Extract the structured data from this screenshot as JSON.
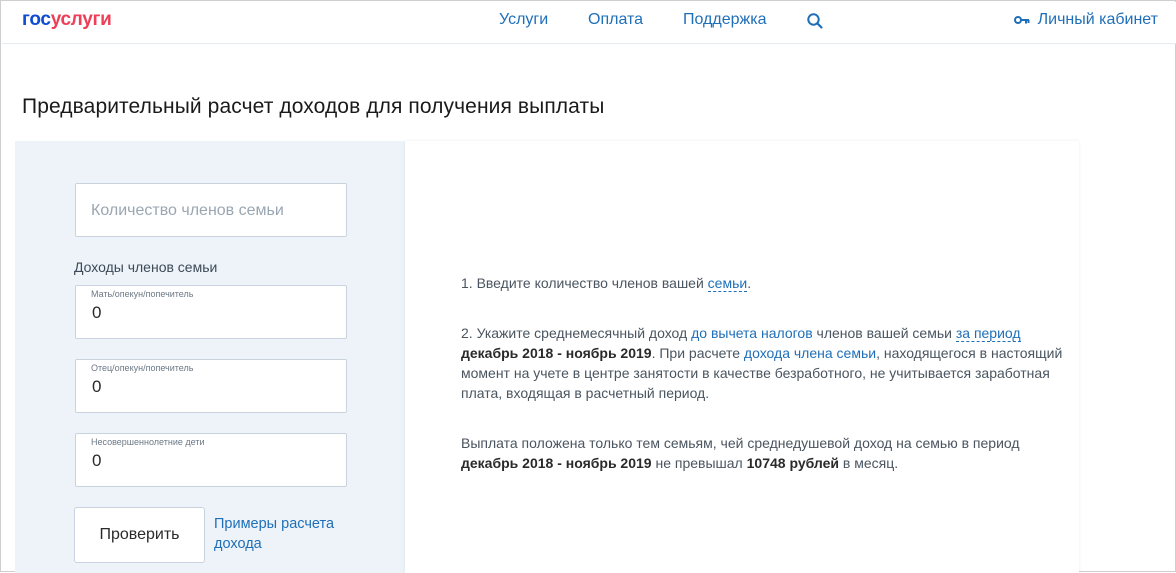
{
  "header": {
    "logo_part1": "гос",
    "logo_part2": "услуги",
    "nav": [
      "Услуги",
      "Оплата",
      "Поддержка"
    ],
    "cabinet_label": "Личный кабинет"
  },
  "page_title": "Предварительный расчет доходов для получения выплаты",
  "form": {
    "family_count_placeholder": "Количество членов семьи",
    "incomes_label": "Доходы членов семьи",
    "fields": [
      {
        "label": "Мать/опекун/попечитель",
        "value": "0"
      },
      {
        "label": "Отец/опекун/попечитель",
        "value": "0"
      },
      {
        "label": "Несовершеннолетние дети",
        "value": "0"
      }
    ],
    "check_button": "Проверить",
    "examples_link": "Примеры расчета дохода"
  },
  "info": {
    "p1_prefix": "1. Введите количество членов вашей ",
    "p1_link": "семьи",
    "p1_suffix": ".",
    "p2_a": "2. Укажите среднемесячный доход ",
    "p2_link1": "до вычета налогов",
    "p2_b": " членов вашей семьи ",
    "p2_link2": "за период",
    "p2_bold": "декабрь 2018 - ноябрь 2019",
    "p2_c": ". При расчете ",
    "p2_link3": "дохода члена семьи",
    "p2_d": ", находящегося в настоящий момент на учете в центре занятости в качестве безработного, не учитывается заработная плата, входящая в расчетный период.",
    "p3_a": "Выплата положена только тем семьям, чей среднедушевой доход на семью в период ",
    "p3_bold1": "декабрь 2018 - ноябрь 2019",
    "p3_b": " не превышал ",
    "p3_bold2": "10748 рублей",
    "p3_c": " в месяц."
  },
  "colors": {
    "brand_blue": "#0d4cd3",
    "brand_red": "#ee3f58",
    "link": "#1f6fb8",
    "panel_bg": "#edf3f9"
  },
  "icons": [
    "search-icon",
    "key-icon"
  ]
}
